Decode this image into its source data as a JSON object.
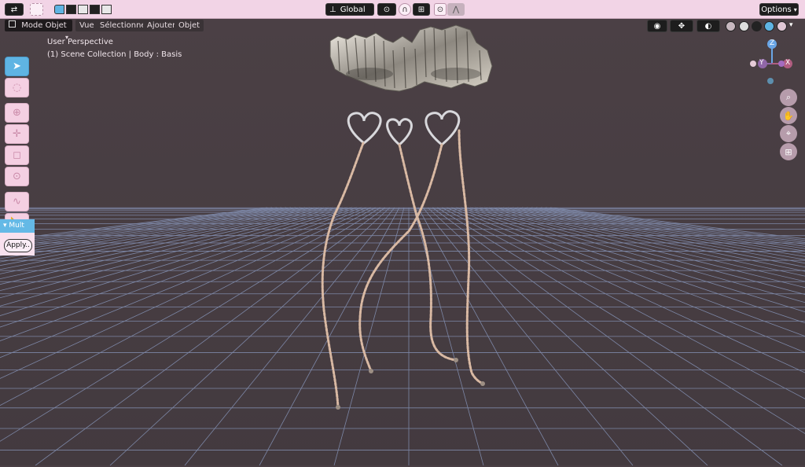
{
  "topbar": {
    "transform_orientation": "Global",
    "options_label": "Options"
  },
  "header": {
    "mode_label": "Mode Objet",
    "menus": [
      "Vue",
      "Sélectionner",
      "Ajouter",
      "Objet"
    ]
  },
  "viewport": {
    "perspective_label": "User Perspective",
    "collection_label": "(1) Scene Collection | Body : Basis",
    "background_color": "#4a3f45",
    "grid_color": "#8fa0c8"
  },
  "gizmo": {
    "z_label": "Z",
    "y_label": "Y",
    "x_label": "X"
  },
  "toolbar": {
    "tools": [
      "select-tool",
      "select-box-tool",
      "cursor-tool",
      "move-tool",
      "scale-tool",
      "transform-tool",
      "annotate-tool",
      "measure-tool"
    ]
  },
  "operator_panel": {
    "title": "Mult",
    "apply_label": "Apply.."
  },
  "colors": {
    "accent": "#5fb4e3",
    "header": "#f2d4e6",
    "chain": "#d9b9a3"
  }
}
